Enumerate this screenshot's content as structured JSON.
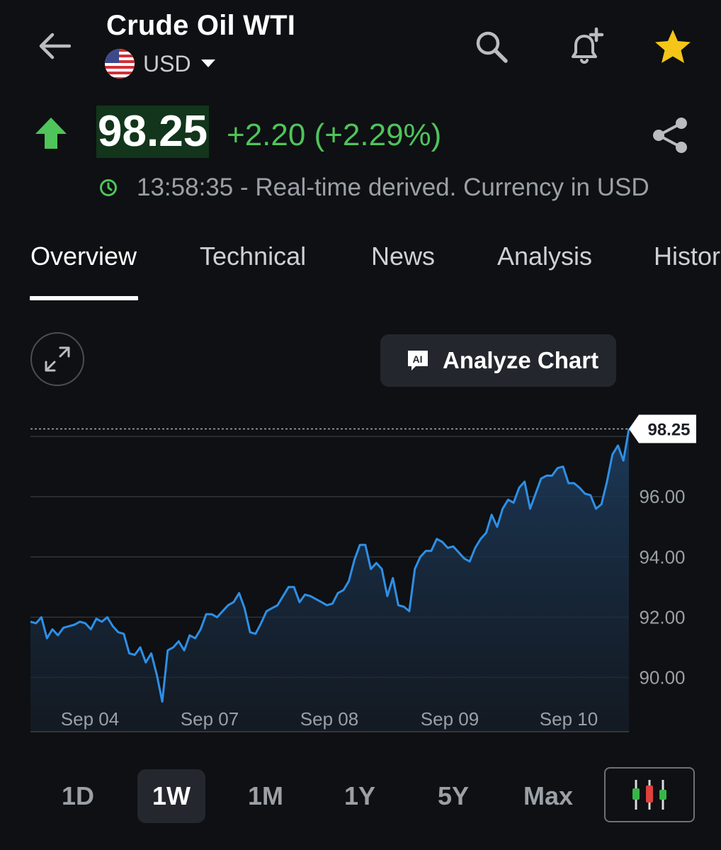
{
  "header": {
    "title": "Crude Oil WTI",
    "currency": "USD",
    "icons": [
      "back-arrow-icon",
      "us-flag-icon",
      "search-icon",
      "add-alert-bell-icon",
      "star-icon"
    ],
    "favorite_color": "#f5c518"
  },
  "quote": {
    "price": "98.25",
    "change": "+2.20 (+2.29%)",
    "status": "13:58:35 - Real-time derived. Currency in USD",
    "up_color": "#4fc45a",
    "price_highlight": "#12351b"
  },
  "tabs": [
    "Overview",
    "Technical",
    "News",
    "Analysis",
    "Histor"
  ],
  "active_tab": "Overview",
  "toolbar": {
    "analyze_label": "Analyze Chart"
  },
  "ranges": [
    "1D",
    "1W",
    "1M",
    "1Y",
    "5Y",
    "Max"
  ],
  "active_range": "1W",
  "chart_data": {
    "type": "area",
    "x_ticks": [
      "Sep 04",
      "Sep 07",
      "Sep 08",
      "Sep 09",
      "Sep 10"
    ],
    "y_ticks": [
      "90.00",
      "92.00",
      "94.00",
      "96.00"
    ],
    "ylim": [
      88.2,
      98.85
    ],
    "last_value_label": "98.25",
    "line_color": "#2e8fe6",
    "grid": true,
    "series": [
      {
        "values": [
          91.85,
          91.8,
          92.0,
          91.3,
          91.6,
          91.4,
          91.65,
          91.7,
          91.75,
          91.85,
          91.8,
          91.6,
          91.95,
          91.85,
          92.0,
          91.7,
          91.5,
          91.45,
          90.8,
          90.75,
          91.0,
          90.5,
          90.8,
          90.1,
          89.2,
          90.9,
          91.0,
          91.2,
          90.9,
          91.4,
          91.3,
          91.6,
          92.1,
          92.1,
          92.0,
          92.2,
          92.4,
          92.5,
          92.8,
          92.3,
          91.5,
          91.45,
          91.8,
          92.2,
          92.3,
          92.4,
          92.7,
          93.0,
          93.0,
          92.5,
          92.75,
          92.7,
          92.6,
          92.5,
          92.4,
          92.45,
          92.8,
          92.9,
          93.2,
          93.9,
          94.4,
          94.4,
          93.6,
          93.8,
          93.6,
          92.7,
          93.3,
          92.4,
          92.35,
          92.2,
          93.6,
          94.0,
          94.2,
          94.2,
          94.6,
          94.5,
          94.3,
          94.35,
          94.15,
          93.95,
          93.85,
          94.3,
          94.6,
          94.8,
          95.4,
          95.0,
          95.6,
          95.9,
          95.8,
          96.3,
          96.5,
          95.6,
          96.1,
          96.6,
          96.7,
          96.7,
          96.95,
          97.0,
          96.45,
          96.45,
          96.3,
          96.1,
          96.05,
          95.6,
          95.75,
          96.5,
          97.4,
          97.7,
          97.2,
          98.25
        ]
      }
    ]
  }
}
